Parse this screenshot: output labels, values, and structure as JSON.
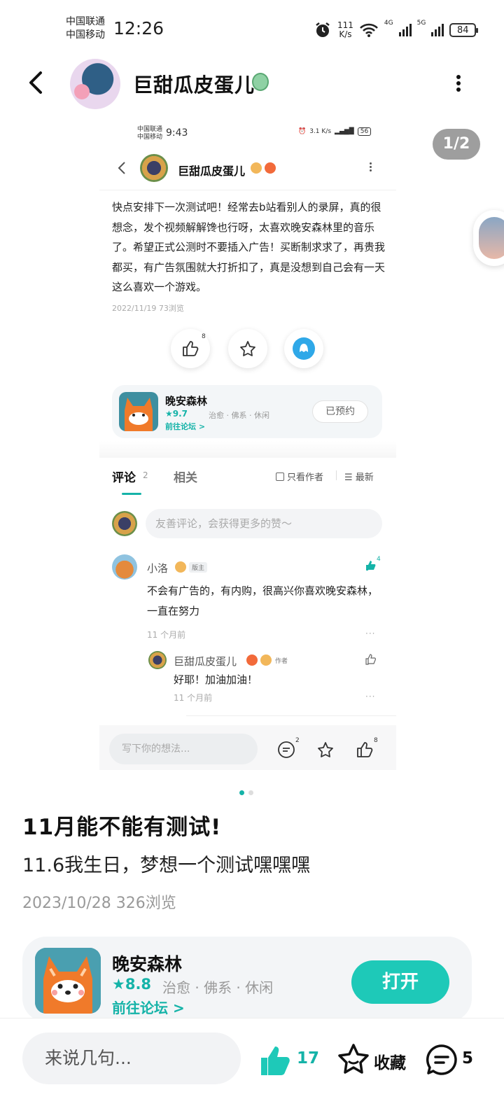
{
  "status_bar": {
    "carrier1": "中国联通",
    "carrier2": "中国移动",
    "time": "12:26",
    "speed": "111",
    "speed_unit": "K/s",
    "net1": "4G",
    "net2": "5G",
    "battery": "84"
  },
  "header": {
    "title": "巨甜瓜皮蛋儿",
    "page_indicator": "1/2"
  },
  "embedded": {
    "status": {
      "carrier1": "中国联通",
      "carrier2": "中国移动",
      "time": "9:43",
      "speed": "3.1",
      "speed_unit": "K/s",
      "battery": "56"
    },
    "author": "巨甜瓜皮蛋儿",
    "body": "快点安排下一次测试吧！经常去b站看别人的录屏，真的很想念，发个视频解解馋也行呀，太喜欢晚安森林里的音乐了。希望正式公测时不要插入广告！买断制求求了，再贵我都买，有广告氛围就大打折扣了，真是没想到自己会有一天这么喜欢一个游戏。",
    "meta": "2022/11/19  73浏览",
    "like_count": "8",
    "app": {
      "name": "晚安森林",
      "rating": "★9.7",
      "tags": "治愈 · 佛系 · 休闲",
      "forum": "前往论坛 >",
      "booked": "已预约"
    },
    "tabs": {
      "comments": "评论",
      "comments_count": "2",
      "related": "相关",
      "only_author": "只看作者",
      "sort": "最新"
    },
    "comment_placeholder": "友善评论，会获得更多的赞～",
    "comment": {
      "user": "小洛",
      "role": "版主",
      "likes": "4",
      "text": "不会有广告的，有内购，很高兴你喜欢晚安森林，一直在努力",
      "time": "11 个月前",
      "more": "···"
    },
    "reply": {
      "user": "巨甜瓜皮蛋儿",
      "role": "作者",
      "text": "好耶！加油加油！",
      "time": "11 个月前",
      "more": "···"
    },
    "bottom": {
      "placeholder": "写下你的想法...",
      "comment_count": "2",
      "like_count": "8"
    }
  },
  "post": {
    "title": "11月能不能有测试!",
    "body": "11.6我生日，梦想一个测试嘿嘿嘿",
    "meta": "2023/10/28  326浏览"
  },
  "app_card": {
    "name": "晚安森林",
    "rating": "★8.8",
    "tags": "治愈 · 佛系 · 休闲",
    "forum": "前往论坛 >",
    "open": "打开"
  },
  "bottom_bar": {
    "placeholder": "来说几句...",
    "like_count": "17",
    "favorite": "收藏",
    "comment_count": "5"
  },
  "colors": {
    "accent": "#15b3a8",
    "button": "#1ec9b8"
  }
}
